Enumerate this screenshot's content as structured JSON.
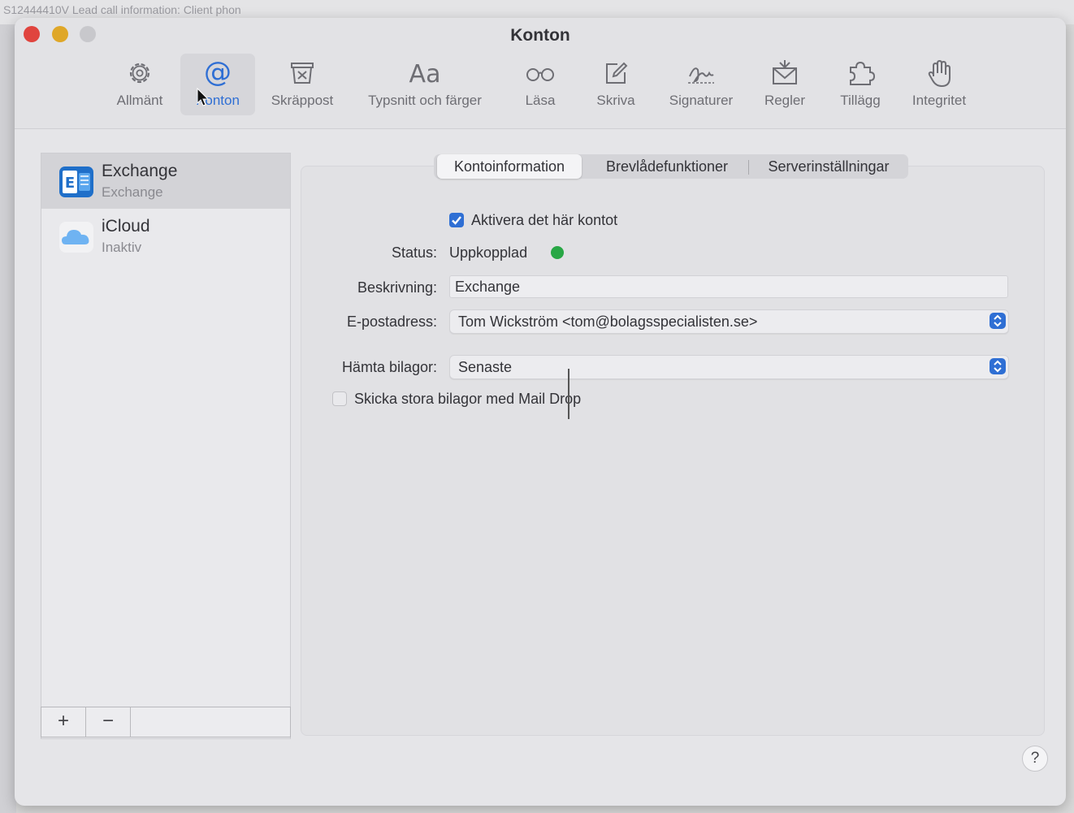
{
  "background": {
    "text": "S12444410V Lead call information: Client phon"
  },
  "window": {
    "title": "Konton"
  },
  "toolbar": [
    {
      "label": "Allmänt",
      "icon": "gear-icon"
    },
    {
      "label": "Konton",
      "icon": "at-sign-icon",
      "selected": true
    },
    {
      "label": "Skräppost",
      "icon": "junk-trash-icon"
    },
    {
      "label": "Typsnitt och färger",
      "icon": "font-aa-icon"
    },
    {
      "label": "Läsa",
      "icon": "glasses-icon"
    },
    {
      "label": "Skriva",
      "icon": "compose-icon"
    },
    {
      "label": "Signaturer",
      "icon": "signature-icon"
    },
    {
      "label": "Regler",
      "icon": "rules-envelope-icon"
    },
    {
      "label": "Tillägg",
      "icon": "puzzle-icon"
    },
    {
      "label": "Integritet",
      "icon": "hand-icon"
    }
  ],
  "accounts": [
    {
      "name": "Exchange",
      "sub": "Exchange",
      "icon": "exchange-icon",
      "selected": true
    },
    {
      "name": "iCloud",
      "sub": "Inaktiv",
      "icon": "icloud-icon"
    }
  ],
  "footer": {
    "add_label": "+",
    "remove_label": "−"
  },
  "tabs": [
    {
      "label": "Kontoinformation",
      "active": true
    },
    {
      "label": "Brevlådefunktioner"
    },
    {
      "label": "Serverinställningar"
    }
  ],
  "form": {
    "activate_label": "Aktivera det här kontot",
    "activate_checked": true,
    "status_label": "Status:",
    "status_value": "Uppkopplad",
    "status_color": "#28a745",
    "description_label": "Beskrivning:",
    "description_value": "Exchange",
    "email_label": "E-postadress:",
    "email_value": "Tom Wickström <tom@bolagsspecialisten.se>",
    "attachments_label": "Hämta bilagor:",
    "attachments_value": "Senaste",
    "maildrop_label": "Skicka stora bilagor med Mail Drop",
    "maildrop_checked": false
  },
  "help": {
    "label": "?"
  },
  "colors": {
    "accent": "#2f6fd4",
    "close": "#e0443e",
    "minimize": "#dfa728"
  }
}
